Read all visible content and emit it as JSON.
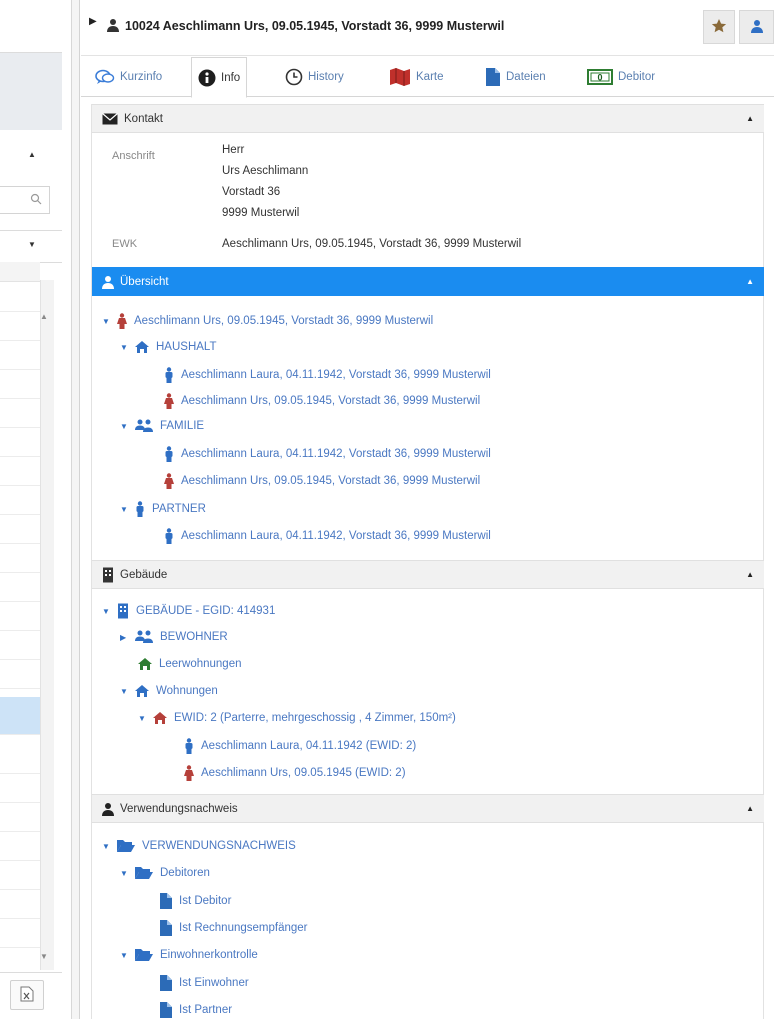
{
  "header": {
    "title": "10024  Aeschlimann Urs, 09.05.1945, Vorstadt 36, 9999 Musterwil"
  },
  "tabs": [
    {
      "label": "Kurzinfo"
    },
    {
      "label": "Info"
    },
    {
      "label": "History"
    },
    {
      "label": "Karte"
    },
    {
      "label": "Dateien"
    },
    {
      "label": "Debitor"
    }
  ],
  "kontakt": {
    "title": "Kontakt",
    "anschrift_label": "Anschrift",
    "anschrift_lines": [
      "Herr",
      "Urs Aeschlimann",
      "Vorstadt 36",
      "9999 Musterwil"
    ],
    "ewk_label": "EWK",
    "ewk_value": "Aeschlimann Urs, 09.05.1945, Vorstadt 36, 9999 Musterwil"
  },
  "uebersicht": {
    "title": "Übersicht",
    "root": "Aeschlimann Urs, 09.05.1945, Vorstadt 36, 9999 Musterwil",
    "haushalt": "HAUSHALT",
    "haushalt_items": [
      "Aeschlimann Laura, 04.11.1942, Vorstadt 36, 9999 Musterwil",
      "Aeschlimann Urs, 09.05.1945, Vorstadt 36, 9999 Musterwil"
    ],
    "familie": "FAMILIE",
    "familie_items": [
      "Aeschlimann Laura, 04.11.1942, Vorstadt 36, 9999 Musterwil",
      "Aeschlimann Urs, 09.05.1945, Vorstadt 36, 9999 Musterwil"
    ],
    "partner": "PARTNER",
    "partner_items": [
      "Aeschlimann Laura, 04.11.1942, Vorstadt 36, 9999 Musterwil"
    ]
  },
  "gebaeude": {
    "title": "Gebäude",
    "root": "GEBÄUDE - EGID: 414931",
    "bewohner": "BEWOHNER",
    "leerwohnungen": "Leerwohnungen",
    "wohnungen": "Wohnungen",
    "ewid": "EWID: 2 (Parterre, mehrgeschossig , 4 Zimmer, 150m²)",
    "ewid_items": [
      "Aeschlimann Laura, 04.11.1942 (EWID: 2)",
      "Aeschlimann Urs, 09.05.1945 (EWID: 2)"
    ]
  },
  "verwendung": {
    "title": "Verwendungsnachweis",
    "root": "VERWENDUNGSNACHWEIS",
    "debitoren": "Debitoren",
    "debitoren_items": [
      "Ist Debitor",
      "Ist Rechnungsempfänger"
    ],
    "einwohnerkontrolle": "Einwohnerkontrolle",
    "einwohner_items": [
      "Ist Einwohner",
      "Ist Partner"
    ]
  },
  "colors": {
    "accent": "#1a8cf0",
    "link": "#4a78c2",
    "male": "#2f6fc4",
    "female": "#b5403a",
    "star": "#8a6a3a"
  }
}
